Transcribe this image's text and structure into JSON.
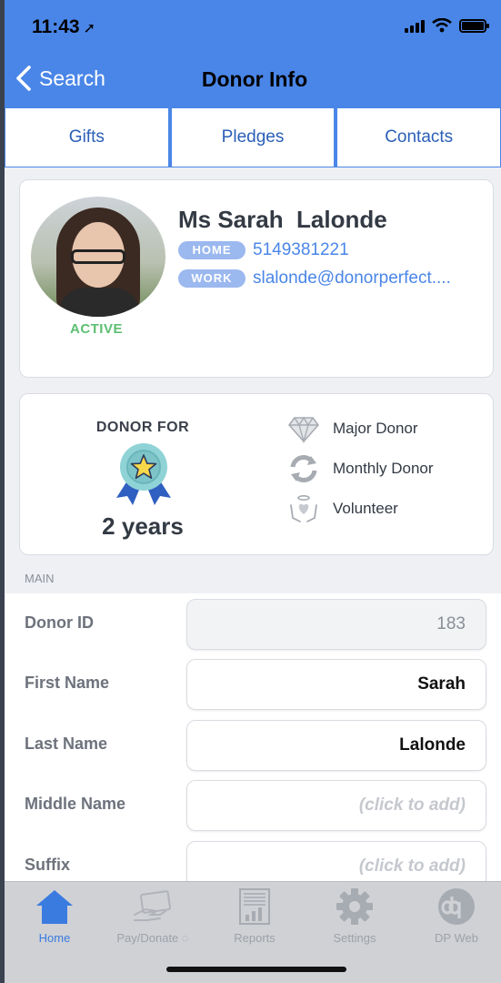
{
  "status_bar": {
    "time": "11:43",
    "location_glyph": "➚"
  },
  "nav": {
    "back_label": "Search",
    "title": "Donor Info"
  },
  "tabs": [
    {
      "label": "Gifts"
    },
    {
      "label": "Pledges"
    },
    {
      "label": "Contacts"
    }
  ],
  "profile": {
    "name": "Ms Sarah  Lalonde",
    "status": "ACTIVE",
    "home_label": "HOME",
    "home_value": "5149381221",
    "work_label": "WORK",
    "work_value": "slalonde@donorperfect...."
  },
  "stats": {
    "donor_for_label": "DONOR FOR",
    "duration": "2 years",
    "attributes": [
      {
        "label": "Major Donor",
        "icon": "diamond-icon"
      },
      {
        "label": "Monthly Donor",
        "icon": "recurring-icon"
      },
      {
        "label": "Volunteer",
        "icon": "volunteer-hands-icon"
      }
    ]
  },
  "section": {
    "label": "MAIN"
  },
  "form": {
    "fields": [
      {
        "label": "Donor ID",
        "value": "183"
      },
      {
        "label": "First Name",
        "value": "Sarah"
      },
      {
        "label": "Last Name",
        "value": "Lalonde"
      },
      {
        "label": "Middle Name",
        "value": "(click to add)"
      },
      {
        "label": "Suffix",
        "value": "(click to add)"
      }
    ]
  },
  "tabbar": {
    "items": [
      {
        "label": "Home",
        "icon": "home-icon"
      },
      {
        "label": "Pay/Donate ◌",
        "icon": "card-payment-icon"
      },
      {
        "label": "Reports",
        "icon": "reports-icon"
      },
      {
        "label": "Settings",
        "icon": "gear-icon"
      },
      {
        "label": "DP Web",
        "icon": "dp-logo-icon"
      }
    ]
  },
  "colors": {
    "header_blue": "#4a86e8",
    "active_green": "#5cbf72",
    "pill_blue": "#9bb8ef",
    "tab_active_blue": "#3a7be0"
  }
}
